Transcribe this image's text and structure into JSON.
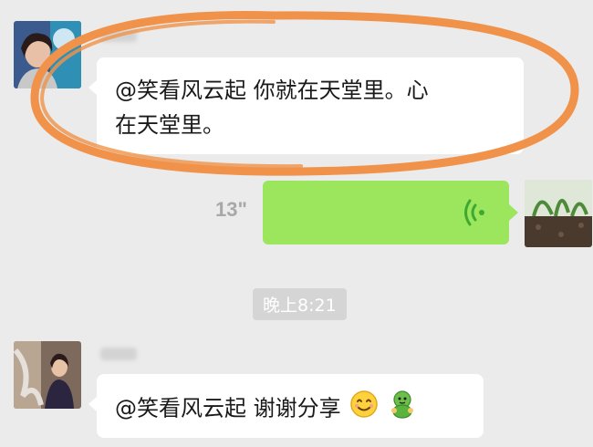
{
  "messages": [
    {
      "side": "left",
      "text_line1": "@笑看风云起  你就在天堂里。心",
      "text_line2": "在天堂里。"
    },
    {
      "side": "right",
      "type": "voice",
      "duration": "13\"",
      "icon": "voice-wave-icon"
    },
    {
      "type": "timestamp",
      "time": "晚上8:21"
    },
    {
      "side": "left",
      "text": "@笑看风云起  谢谢分享",
      "emojis": [
        "smile-emoji",
        "green-figure-emoji"
      ]
    }
  ],
  "colors": {
    "background": "#ebebeb",
    "bubble_incoming": "#ffffff",
    "bubble_outgoing": "#9ce65e",
    "voice_icon": "#3fa92f",
    "annotation_stroke": "#f0924a"
  }
}
